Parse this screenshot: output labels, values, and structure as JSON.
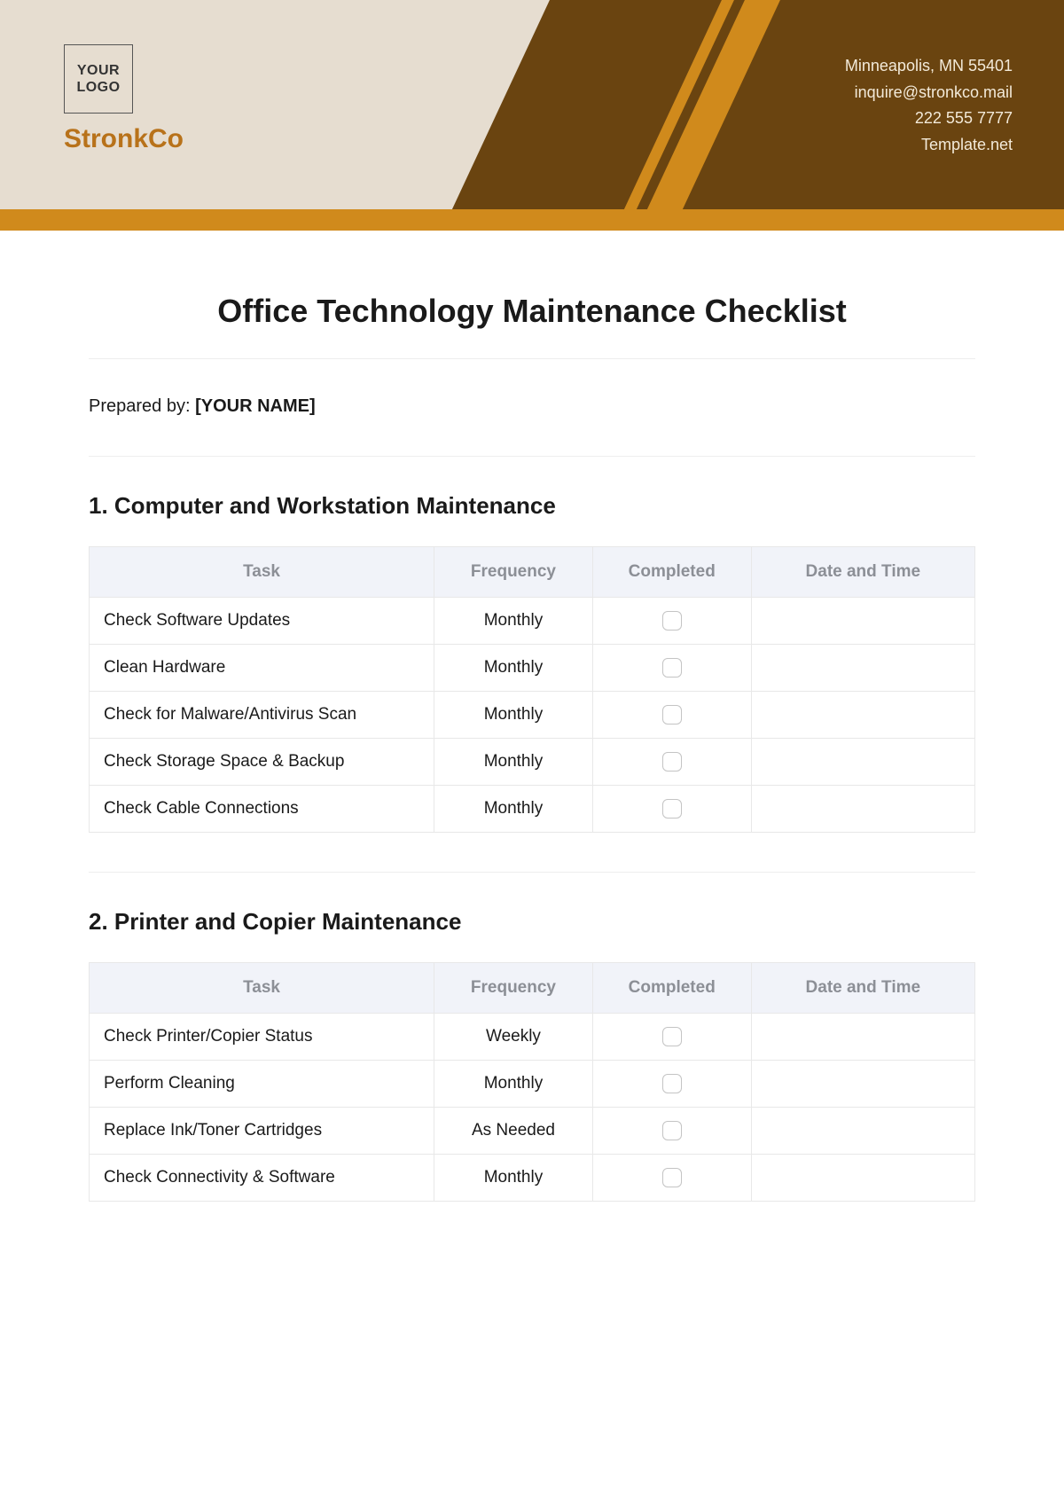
{
  "header": {
    "logo_text": "YOUR LOGO",
    "company_name": "StronkCo",
    "contact": {
      "address": "Minneapolis, MN 55401",
      "email": "inquire@stronkco.mail",
      "phone": "222 555 7777",
      "site": "Template.net"
    }
  },
  "title": "Office Technology Maintenance Checklist",
  "prepared_label": "Prepared by: ",
  "prepared_value": "[YOUR NAME]",
  "columns": {
    "task": "Task",
    "frequency": "Frequency",
    "completed": "Completed",
    "datetime": "Date and Time"
  },
  "sections": [
    {
      "title": "1. Computer and Workstation Maintenance",
      "rows": [
        {
          "task": "Check Software Updates",
          "frequency": "Monthly"
        },
        {
          "task": "Clean Hardware",
          "frequency": "Monthly"
        },
        {
          "task": "Check for Malware/Antivirus Scan",
          "frequency": "Monthly"
        },
        {
          "task": "Check Storage Space & Backup",
          "frequency": "Monthly"
        },
        {
          "task": "Check Cable Connections",
          "frequency": "Monthly"
        }
      ]
    },
    {
      "title": "2. Printer and Copier Maintenance",
      "rows": [
        {
          "task": "Check Printer/Copier Status",
          "frequency": "Weekly"
        },
        {
          "task": "Perform Cleaning",
          "frequency": "Monthly"
        },
        {
          "task": "Replace Ink/Toner Cartridges",
          "frequency": "As Needed"
        },
        {
          "task": "Check Connectivity & Software",
          "frequency": "Monthly"
        }
      ]
    }
  ]
}
